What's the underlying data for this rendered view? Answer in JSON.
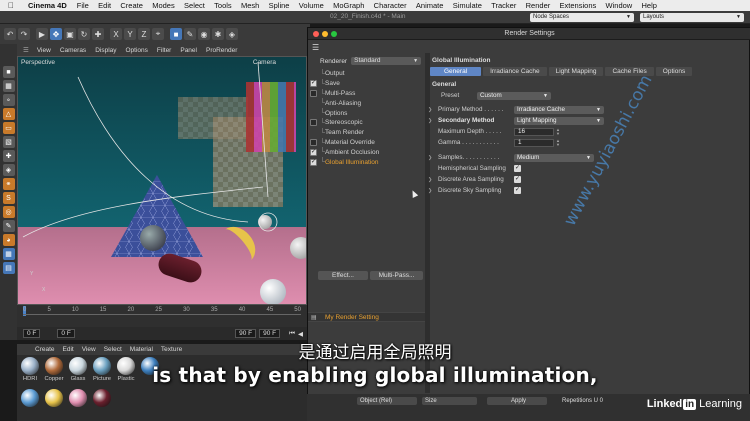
{
  "menubar": {
    "app": "Cinema 4D",
    "items": [
      "File",
      "Edit",
      "Create",
      "Modes",
      "Select",
      "Tools",
      "Mesh",
      "Spline",
      "Volume",
      "MoGraph",
      "Character",
      "Animate",
      "Simulate",
      "Tracker",
      "Render",
      "Extensions",
      "Window",
      "Help"
    ]
  },
  "titlebar": {
    "doc_title": "02_20_Finish.c4d * - Main",
    "node_spaces": "Node Spaces",
    "layouts": "Layouts"
  },
  "viewport": {
    "menu": [
      "View",
      "Cameras",
      "Display",
      "Options",
      "Filter",
      "Panel",
      "ProRender"
    ],
    "label": "Perspective",
    "camera": "Camera",
    "axis_y": "Y",
    "axis_x": "X"
  },
  "timeline": {
    "ticks": [
      "0",
      "5",
      "10",
      "15",
      "20",
      "25",
      "30",
      "35",
      "40",
      "45",
      "50"
    ],
    "start": "0 F",
    "current": "0 F",
    "end": "90 F",
    "end2": "90 F"
  },
  "materials": {
    "menu": [
      "Create",
      "Edit",
      "View",
      "Select",
      "Material",
      "Texture"
    ],
    "items": [
      {
        "name": "HDRI",
        "color": "#9ab0c8"
      },
      {
        "name": "Copper",
        "color": "#b06a3a"
      },
      {
        "name": "Glass",
        "color": "#c9d6de"
      },
      {
        "name": "Picture",
        "color": "#6aa0c0"
      },
      {
        "name": "Plastic",
        "color": "#d9d9d9"
      },
      {
        "name": "",
        "color": "#3d7fbe"
      },
      {
        "name": "",
        "color": "#5b9bd3"
      },
      {
        "name": "",
        "color": "#e7c34a"
      },
      {
        "name": "",
        "color": "#e08fb0"
      },
      {
        "name": "",
        "color": "#6a1f2d"
      }
    ]
  },
  "render_settings": {
    "title": "Render Settings",
    "renderer_label": "Renderer",
    "renderer_value": "Standard",
    "tree": [
      {
        "label": "Output",
        "check": "none"
      },
      {
        "label": "Save",
        "check": "on"
      },
      {
        "label": "Multi-Pass",
        "check": "off"
      },
      {
        "label": "Anti-Aliasing",
        "check": "none"
      },
      {
        "label": "Options",
        "check": "none"
      },
      {
        "label": "Stereoscopic",
        "check": "off"
      },
      {
        "label": "Team Render",
        "check": "none"
      },
      {
        "label": "Material Override",
        "check": "off"
      },
      {
        "label": "Ambient Occlusion",
        "check": "on"
      },
      {
        "label": "Global Illumination",
        "check": "on"
      }
    ],
    "effect_button": "Effect...",
    "multipass_button": "Multi-Pass...",
    "setting_name": "My Render Setting",
    "panel_title": "Global Illumination",
    "tabs": [
      "General",
      "Irradiance Cache",
      "Light Mapping",
      "Cache Files",
      "Options"
    ],
    "section": "General",
    "preset_label": "Preset",
    "preset_value": "Custom",
    "primary_label": "Primary Method . . . . . .",
    "primary_value": "Irradiance Cache",
    "secondary_label": "Secondary Method",
    "secondary_value": "Light Mapping",
    "depth_label": "Maximum Depth . . . . .",
    "depth_value": "16",
    "gamma_label": "Gamma . . . . . . . . . . .",
    "gamma_value": "1",
    "samples_label": "Samples. . . . . . . . . . .",
    "samples_value": "Medium",
    "hemi_label": "Hemispherical Sampling",
    "area_label": "Discrete Area Sampling",
    "sky_label": "Discrete Sky Sampling"
  },
  "attribute_strip": {
    "object": "Object (Rel)",
    "size": "Size",
    "apply": "Apply",
    "repetitions": "Repetitions U 0"
  },
  "subtitles": {
    "cn": "是通过启用全局照明",
    "en": "is that by enabling global illumination,"
  },
  "watermark": "www.yuyiaoshi.com",
  "brand": {
    "linked": "Linked",
    "in": "in",
    "learning": "Learning"
  }
}
